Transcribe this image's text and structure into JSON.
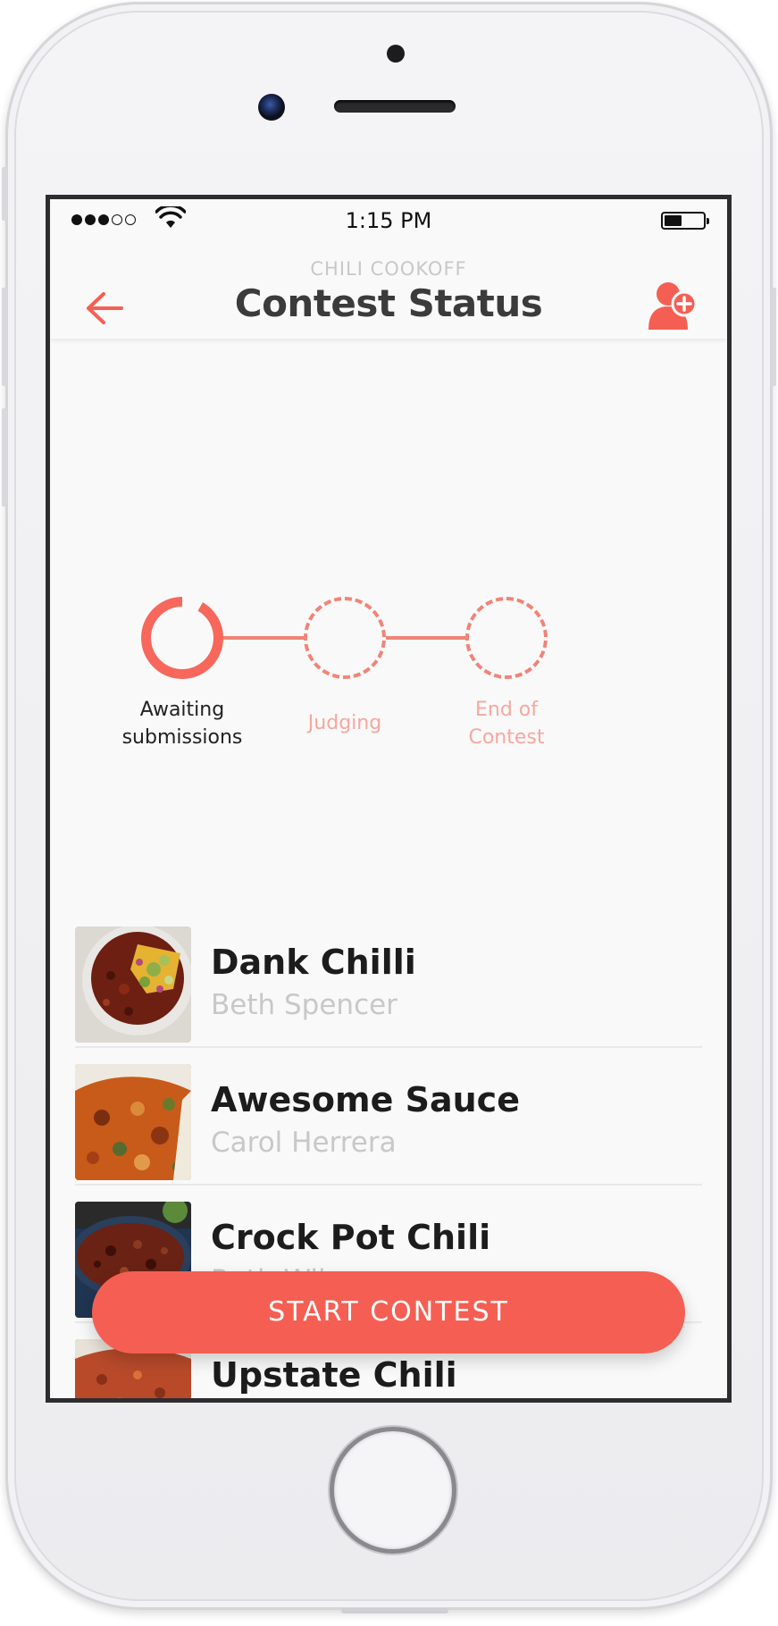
{
  "status_bar": {
    "time": "1:15 PM",
    "signal_bars": 5,
    "signal_filled": 3,
    "battery_level": 0.45
  },
  "nav": {
    "subtitle": "CHILI COOKOFF",
    "title": "Contest Status",
    "back_icon": "arrow-left-icon",
    "action_icon": "add-user-icon",
    "accent": "#f55f53"
  },
  "progress": {
    "steps": [
      {
        "label_line1": "Awaiting",
        "label_line2": "submissions",
        "state": "active"
      },
      {
        "label_line1": "Judging",
        "label_line2": "",
        "state": "pending"
      },
      {
        "label_line1": "End of",
        "label_line2": "Contest",
        "state": "pending"
      }
    ]
  },
  "entries": [
    {
      "title": "Dank Chilli",
      "author": "Beth Spencer"
    },
    {
      "title": "Awesome Sauce",
      "author": "Carol Herrera"
    },
    {
      "title": "Crock Pot Chili",
      "author": "Ruth Wilson"
    },
    {
      "title": "Upstate Chili",
      "author": ""
    }
  ],
  "action": {
    "start_label": "START CONTEST"
  }
}
